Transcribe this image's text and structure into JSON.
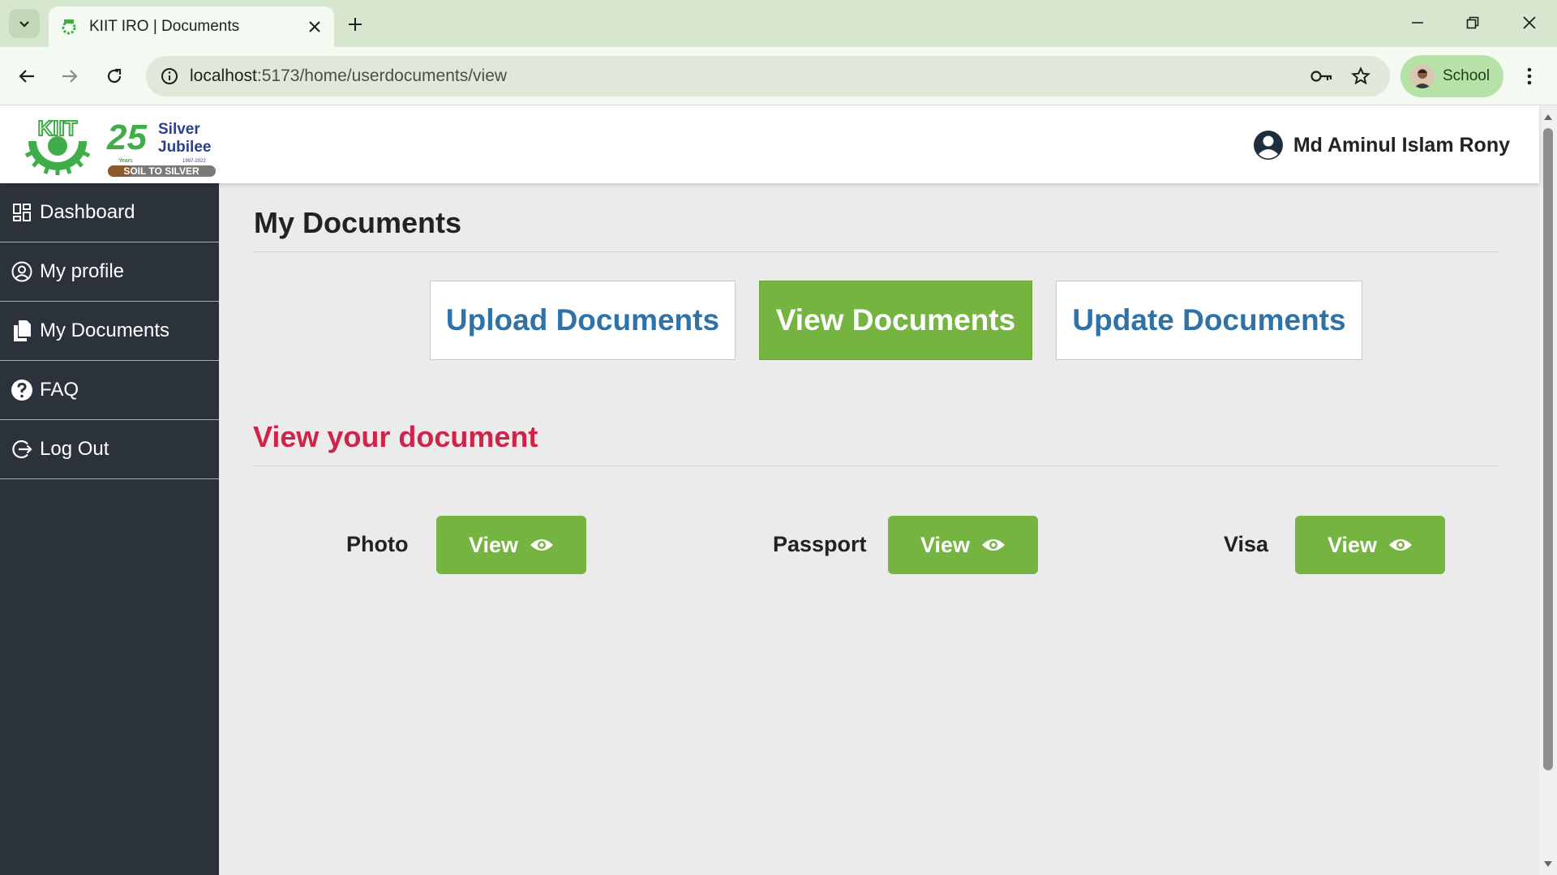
{
  "browser": {
    "tab_title": "KIIT IRO | Documents",
    "url_host": "localhost",
    "url_path": ":5173/home/userdocuments/view",
    "profile_label": "School"
  },
  "header": {
    "logo_jubilee_line1": "Silver",
    "logo_jubilee_line2": "Jubilee",
    "logo_jubilee_years": "Years",
    "logo_jubilee_dates": "1997-2022",
    "logo_jubilee_banner": "SOIL TO SILVER",
    "logo_jubilee_number": "25",
    "user_name": "Md Aminul Islam Rony"
  },
  "sidebar": {
    "items": [
      {
        "label": "Dashboard",
        "icon": "dashboard-icon"
      },
      {
        "label": "My profile",
        "icon": "user-circle-icon"
      },
      {
        "label": "My Documents",
        "icon": "documents-icon"
      },
      {
        "label": "FAQ",
        "icon": "question-icon"
      },
      {
        "label": "Log Out",
        "icon": "logout-icon"
      }
    ]
  },
  "main": {
    "title": "My Documents",
    "tabs": [
      {
        "label": "Upload Documents",
        "active": false
      },
      {
        "label": "View Documents",
        "active": true
      },
      {
        "label": "Update Documents",
        "active": false
      }
    ],
    "subtitle": "View your document",
    "documents": [
      {
        "label": "Photo",
        "button": "View"
      },
      {
        "label": "Passport",
        "button": "View"
      },
      {
        "label": "Visa",
        "button": "View"
      }
    ]
  },
  "colors": {
    "sidebar_bg": "#2b323b",
    "accent_green": "#76b442",
    "tab_text_blue": "#2f72a8",
    "subtitle_red": "#d0234a"
  }
}
